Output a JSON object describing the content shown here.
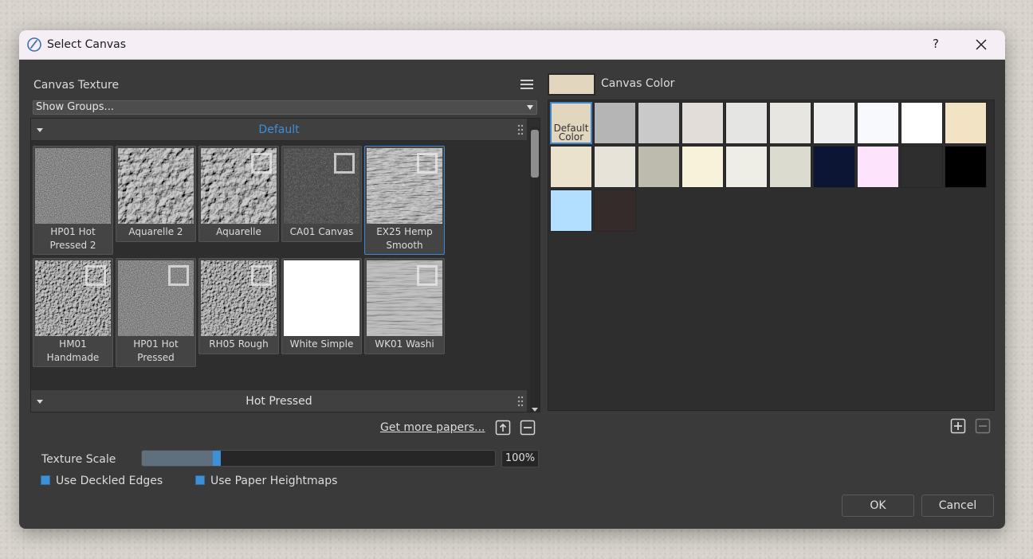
{
  "window": {
    "title": "Select Canvas",
    "help": "?"
  },
  "texture": {
    "label": "Canvas Texture",
    "groups_dropdown": "Show Groups...",
    "groups": [
      {
        "name": "Default"
      },
      {
        "name": "Hot Pressed"
      }
    ],
    "tiles": [
      {
        "name": "HP01 Hot Pressed 2",
        "badge": false,
        "selected": false,
        "texture": "smooth"
      },
      {
        "name": "Aquarelle 2",
        "badge": false,
        "selected": false,
        "texture": "bumpy"
      },
      {
        "name": "Aquarelle",
        "badge": true,
        "selected": false,
        "texture": "bumpy"
      },
      {
        "name": "CA01 Canvas",
        "badge": true,
        "selected": false,
        "texture": "weave"
      },
      {
        "name": "EX25 Hemp Smooth",
        "badge": true,
        "selected": true,
        "texture": "hemp"
      },
      {
        "name": "HM01 Handmade",
        "badge": true,
        "selected": false,
        "texture": "rough"
      },
      {
        "name": "HP01 Hot Pressed",
        "badge": true,
        "selected": false,
        "texture": "smooth"
      },
      {
        "name": "RH05 Rough",
        "badge": true,
        "selected": false,
        "texture": "rough"
      },
      {
        "name": "White Simple",
        "badge": false,
        "selected": false,
        "texture": "white"
      },
      {
        "name": "WK01 Washi",
        "badge": true,
        "selected": false,
        "texture": "washi"
      }
    ],
    "more_link": "Get more papers...",
    "scale_label": "Texture Scale",
    "scale_value": "100%",
    "scale_fraction": 0.21,
    "deckled_label": "Use Deckled Edges",
    "heightmap_label": "Use Paper Heightmaps"
  },
  "colors": {
    "label": "Canvas Color",
    "current": "#e3d6bf",
    "default_label": "Default Color",
    "swatches": [
      "#e3d6bf",
      "#b5b5b5",
      "#c9c9c9",
      "#e2ddd9",
      "#e5e5e3",
      "#e8e6e0",
      "#eeeeee",
      "#f8f9fc",
      "#ffffff",
      "#f3e3c5",
      "#ebe2cd",
      "#e7e3d8",
      "#bcbbae",
      "#f8f2da",
      "#eeede6",
      "#dcdbcf",
      "#0c1634",
      "#fde3fb",
      "#2e2e2e",
      "#000000",
      "#b2dfff",
      "#352b2a"
    ]
  },
  "buttons": {
    "ok": "OK",
    "cancel": "Cancel"
  }
}
